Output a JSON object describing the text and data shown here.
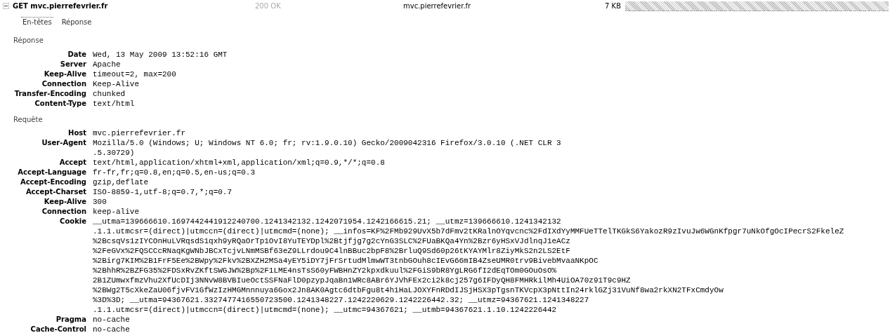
{
  "request": {
    "method_url": "GET mvc.pierrefevrier.fr",
    "status": "200 OK",
    "domain": "mvc.pierrefevrier.fr",
    "size": "7 KB",
    "expanded": true
  },
  "tabs": [
    {
      "label": "En-têtes",
      "selected": true
    },
    {
      "label": "Réponse",
      "selected": false
    }
  ],
  "sections": [
    {
      "title": "Réponse",
      "headers": [
        {
          "name": "Date",
          "lines": [
            "Wed, 13 May 2009 13:52:16 GMT"
          ]
        },
        {
          "name": "Server",
          "lines": [
            "Apache"
          ]
        },
        {
          "name": "Keep-Alive",
          "lines": [
            "timeout=2, max=200"
          ]
        },
        {
          "name": "Connection",
          "lines": [
            "Keep-Alive"
          ]
        },
        {
          "name": "Transfer-Encoding",
          "lines": [
            "chunked"
          ]
        },
        {
          "name": "Content-Type",
          "lines": [
            "text/html"
          ]
        }
      ]
    },
    {
      "title": "Requête",
      "headers": [
        {
          "name": "Host",
          "lines": [
            "mvc.pierrefevrier.fr"
          ]
        },
        {
          "name": "User-Agent",
          "lines": [
            "Mozilla/5.0 (Windows; U; Windows NT 6.0; fr; rv:1.9.0.10) Gecko/2009042316 Firefox/3.0.10 (.NET CLR 3",
            ".5.30729)"
          ]
        },
        {
          "name": "Accept",
          "lines": [
            "text/html,application/xhtml+xml,application/xml;q=0.9,*/*;q=0.8"
          ]
        },
        {
          "name": "Accept-Language",
          "lines": [
            "fr-fr,fr;q=0.8,en;q=0.5,en-us;q=0.3"
          ]
        },
        {
          "name": "Accept-Encoding",
          "lines": [
            "gzip,deflate"
          ]
        },
        {
          "name": "Accept-Charset",
          "lines": [
            "ISO-8859-1,utf-8;q=0.7,*;q=0.7"
          ]
        },
        {
          "name": "Keep-Alive",
          "lines": [
            "300"
          ]
        },
        {
          "name": "Connection",
          "lines": [
            "keep-alive"
          ]
        },
        {
          "name": "Cookie",
          "lines": [
            "__utma=139666610.1697442441912240700.1241342132.1242071954.1242166615.21; __utmz=139666610.1241342132",
            ".1.1.utmcsr=(direct)|utmccn=(direct)|utmcmd=(none); __infos=KF%2FMb929UvX5b7dFmv2tKRalnOYqvcnc%2FdIXdYyMMFUeTTelTKGkS6YakozR9zIvuJw6WGnKfpgr7uNkOfgOcIPecrS2FkeleZ",
            "%2BcsqVs1zIYCOnHuLVRqsdS1qxh9yRQaOrTp1OvI8YuTEYDpl%2Btjfjg7g2cYnG3SLC%2FUaBKQa4Yn%2Bzr6yHSxVJdlnqJ1eACz",
            "%2FeGVx%2FQSCCcRNaqKgWNbJBCxTcjvLNmMSBf63eZ9LLrdou9C4lnBBuc2bpF8%2BrluQ9Sd60p26tKYAYMlr8ZiyMkS2n2LS2EtF",
            "%2Birg7KIM%2B1FrF5Ee%2BWpy%2Fkv%2BXZH2MSa4yEY5iDY7jFrSrtudMlmwWT3tnbGOuh8cIEvG66mIB4ZseUMR0trv9BivebMvaaNKpOC",
            "%2BhhR%2BZFG35%2FDSxRvZKftSWGJW%2Bp%2F1LME4nsTsS60yFWBHnZY2kpxdkuul%2FGiS9bR8YgLRG6fI2dEqTOm0GOuOsO%",
            "2B1ZUmwxfmzVhu2XfUcDIj3NNvW8BVBIueOctSSFNaFlD0pzypJqaBn1WRc8ABr6YJVhFEx2ci2k8cj257g6IFDyQH8FMHRkilMh4UiOA70z91T9c9HZ",
            "%2BWg2T5cXkeZaU06fjvFV1GfWzIzHMGMnnnuya6Gox2Jn8AK0Agtc6dtbFgu8t4h1HaLJOXYFnRDdIJSjHSX3pTgsnTKVcpX3pNttIn24rklGZj31VuNf8wa2rkXN2TFxCmdyOw",
            "%3D%3D; __utma=94367621.3327477416550723500.1241348227.1242220629.1242226442.32; __utmz=94367621.1241348227",
            ".1.1.utmcsr=(direct)|utmccn=(direct)|utmcmd=(none); __utmc=94367621; __utmb=94367621.1.10.1242226442"
          ]
        },
        {
          "name": "Pragma",
          "lines": [
            "no-cache"
          ]
        },
        {
          "name": "Cache-Control",
          "lines": [
            "no-cache"
          ]
        }
      ]
    }
  ]
}
